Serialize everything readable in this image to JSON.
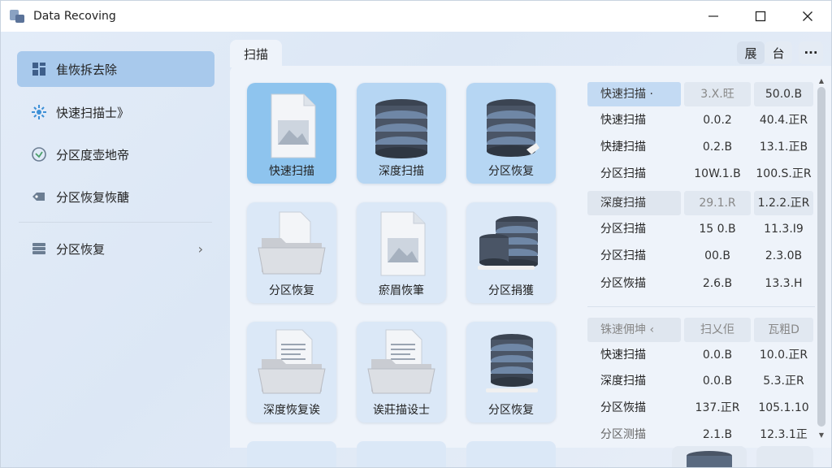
{
  "window": {
    "title": "Data Recoving",
    "minimize_icon": "minimize-icon",
    "maximize_icon": "maximize-icon",
    "close_icon": "close-icon"
  },
  "sidebar": {
    "items": [
      {
        "label": "隹恢拆去除",
        "icon": "grid-icon",
        "active": true
      },
      {
        "label": "快速扫描士》",
        "icon": "scan-icon"
      },
      {
        "label": "分区度壶地帝",
        "icon": "shield-icon"
      },
      {
        "label": "分区恢复恢醣",
        "icon": "tag-icon"
      },
      {
        "label": "分区恢复",
        "icon": "drive-icon",
        "chevron": "›"
      }
    ]
  },
  "tab": {
    "label": "扫描"
  },
  "toolbar": {
    "btn1": "展",
    "btn2": "台",
    "more": "···"
  },
  "tiles": [
    {
      "label": "快速扫描",
      "icon": "image-file-icon"
    },
    {
      "label": "深度扫描",
      "icon": "database-icon"
    },
    {
      "label": "分区恢复",
      "icon": "database-icon"
    },
    {
      "label": "分区恢复",
      "icon": "folder-icon"
    },
    {
      "label": "瘀眉恢筆",
      "icon": "image-file-icon"
    },
    {
      "label": "分区捐獲",
      "icon": "database-icon"
    },
    {
      "label": "深度恢复诶",
      "icon": "document-folder-icon"
    },
    {
      "label": "诶莊描设士",
      "icon": "document-folder-icon"
    },
    {
      "label": "分区恢复",
      "icon": "database-icon"
    }
  ],
  "table": {
    "sections": [
      {
        "header": [
          "快速扫描 ·",
          "3.X.旺",
          "50.0.B"
        ],
        "rows": [
          [
            "快速扫描",
            "0.0.2",
            "40.4.正R"
          ],
          [
            "快捷扫描",
            "0.2.B",
            "13.1.正B"
          ],
          [
            "分区扫描",
            "10W.1.B",
            "100.S.正R"
          ]
        ]
      },
      {
        "header": [
          "深度扫描",
          "29.1.R",
          "1.2.2.正R"
        ],
        "rows": [
          [
            "分区扫描",
            "15 0.B",
            "11.3.I9"
          ],
          [
            "分区扫描",
            "00.B",
            "2.3.0B"
          ],
          [
            "分区恢描",
            "2.6.B",
            "13.3.H"
          ]
        ]
      },
      {
        "header": [
          "铢速佣坤 ‹",
          "扫乂佢",
          "瓦粗D"
        ],
        "rows": [
          [
            "快速扫描",
            "0.0.B",
            "10.0.正R"
          ],
          [
            "深度扫描",
            "0.0.B",
            "5.3.正R"
          ],
          [
            "分区恢描",
            "137.正R",
            "105.1.10"
          ],
          [
            "分区测描",
            "2.1.B",
            "12.3.1正"
          ]
        ]
      }
    ]
  },
  "scrollbar": {
    "up": "▲",
    "down": "▼"
  },
  "colors": {
    "accent": "#8ec4ee",
    "active_nav": "#a8c9ec",
    "tile": "#dbe8f7"
  }
}
